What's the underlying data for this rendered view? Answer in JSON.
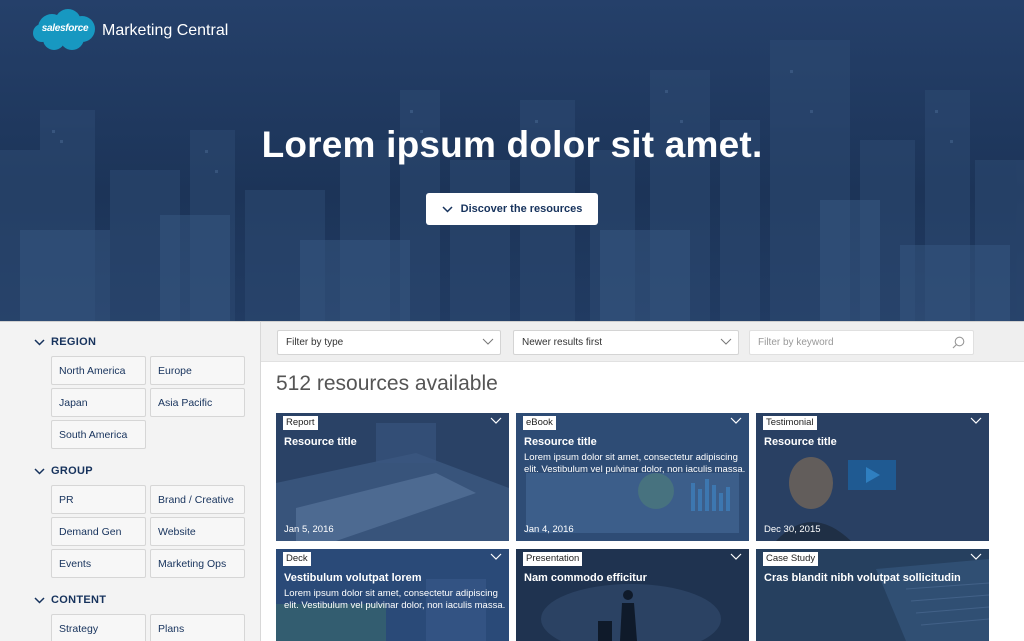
{
  "brand": {
    "logo_text": "salesforce",
    "app_name": "Marketing Central"
  },
  "hero": {
    "title": "Lorem ipsum dolor sit amet.",
    "cta_label": "Discover the resources"
  },
  "sidebar": {
    "sections": [
      {
        "label": "REGION",
        "items": [
          "North America",
          "Europe",
          "Japan",
          "Asia Pacific",
          "South America"
        ]
      },
      {
        "label": "GROUP",
        "items": [
          "PR",
          "Brand / Creative",
          "Demand Gen",
          "Website",
          "Events",
          "Marketing Ops"
        ]
      },
      {
        "label": "CONTENT",
        "items": [
          "Strategy",
          "Plans"
        ]
      }
    ]
  },
  "filters": {
    "type_select": "Filter by type",
    "sort_select": "Newer results first",
    "keyword_placeholder": "Filter by keyword"
  },
  "results": {
    "count_text": "512 resources available"
  },
  "cards": [
    {
      "tag": "Report",
      "title": "Resource title",
      "desc": "",
      "date": "Jan 5, 2016"
    },
    {
      "tag": "eBook",
      "title": "Resource title",
      "desc": "Lorem ipsum dolor sit amet, consectetur adipiscing elit. Vestibulum vel pulvinar dolor, non iaculis massa.",
      "date": "Jan 4, 2016"
    },
    {
      "tag": "Testimonial",
      "title": "Resource title",
      "desc": "",
      "date": "Dec 30, 2015"
    },
    {
      "tag": "Deck",
      "title": "Vestibulum volutpat lorem",
      "desc": "Lorem ipsum dolor sit amet, consectetur adipiscing elit. Vestibulum vel pulvinar dolor, non iaculis massa.",
      "date": ""
    },
    {
      "tag": "Presentation",
      "title": "Nam commodo efficitur",
      "desc": "",
      "date": ""
    },
    {
      "tag": "Case Study",
      "title": "Cras blandit nibh volutpat sollicitudin",
      "desc": "",
      "date": ""
    }
  ],
  "colors": {
    "hero_bg": "#1e3a5f",
    "accent": "#16325c",
    "brand_blue": "#1798c1"
  },
  "icons": {
    "chevron": "chevron-down-icon",
    "search": "search-icon",
    "cloud": "salesforce-cloud-logo",
    "play": "play-icon"
  }
}
